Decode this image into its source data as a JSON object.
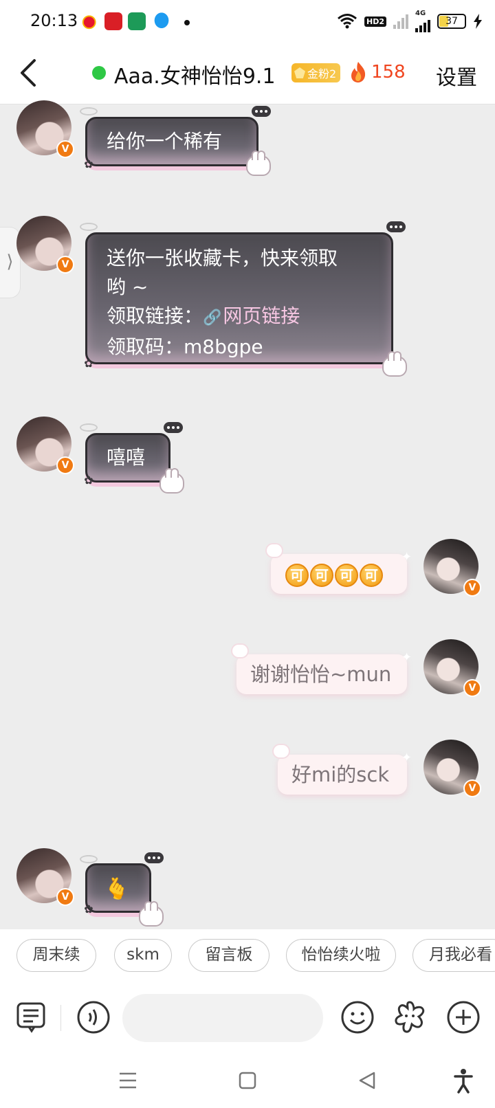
{
  "status_bar": {
    "time": "20:13",
    "hd_badge": "HD2",
    "network": "4G",
    "battery_level": "37",
    "battery_percent": 37
  },
  "header": {
    "title": "Aaa.女神怡怡9.1",
    "fan_badge": "金粉2",
    "fire_count": "158",
    "settings_label": "设置",
    "online_color": "#2ec845"
  },
  "side_tab": {
    "glyph": "⟩"
  },
  "messages": [
    {
      "side": "left",
      "text": "给你一个稀有"
    },
    {
      "side": "left",
      "lines": [
        "送你一张收藏卡，快来领取",
        "哟 ~"
      ],
      "link_label": "领取链接：",
      "link_text": "网页链接",
      "code_label": "领取码：",
      "code": "m8bgpe"
    },
    {
      "side": "left",
      "text": "嘻嘻"
    },
    {
      "side": "right",
      "emoji_text": [
        "可",
        "可",
        "可",
        "可"
      ]
    },
    {
      "side": "right",
      "text": "谢谢怡怡~mun"
    },
    {
      "side": "right",
      "text": "好mi的sck"
    },
    {
      "side": "left",
      "emoji": "🫰"
    }
  ],
  "verified_badge": "V",
  "quick_replies": [
    "周末续",
    "skm",
    "留言板",
    "怡怡续火啦",
    "月我必看"
  ],
  "input": {
    "placeholder": ""
  },
  "icons": {
    "back": "chevron-left-icon",
    "menu": "menu-list-icon",
    "voice": "voice-icon",
    "emoji": "smiley-icon",
    "sticker": "flower-sticker-icon",
    "add": "plus-circle-icon"
  },
  "colors": {
    "accent": "#f07a12",
    "fire": "#f0451f",
    "bubble_dark": "#4c4a50",
    "bubble_pink": "#fdf2f3"
  }
}
